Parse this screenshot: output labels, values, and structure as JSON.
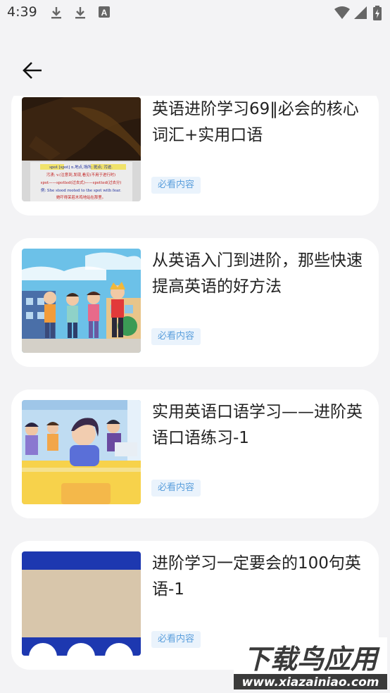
{
  "status_bar": {
    "time": "4:39",
    "icons": [
      "download-icon",
      "download-icon",
      "a-box-icon",
      "wifi-icon",
      "signal-icon",
      "battery-charging-icon"
    ]
  },
  "top_bar": {
    "back_icon": "arrow-left-icon"
  },
  "cards": [
    {
      "title": "英语进阶学习69‖必会的核心词汇+实用口语",
      "tag": "必看内容",
      "thumb_text": [
        "spot [spot] n.地点,场所; 斑点; 污迹.",
        "污渍; v.(注意到,发现,看见(不用于进行时)",
        "spot——spotted(过去式)——spotted(过去分)",
        "例: She stood rooted to the spot with fear.",
        "她吓得呆若木鸡地站在那里。"
      ]
    },
    {
      "title": "从英语入门到进阶，那些快速提高英语的好方法",
      "tag": "必看内容"
    },
    {
      "title": "实用英语口语学习——进阶英语口语练习-1",
      "tag": "必看内容"
    },
    {
      "title": "进阶学习一定要会的100句英语-1",
      "tag": "必看内容"
    }
  ],
  "watermark": {
    "brand": "下载鸟应用",
    "url": "www.xiazainiao.com"
  }
}
